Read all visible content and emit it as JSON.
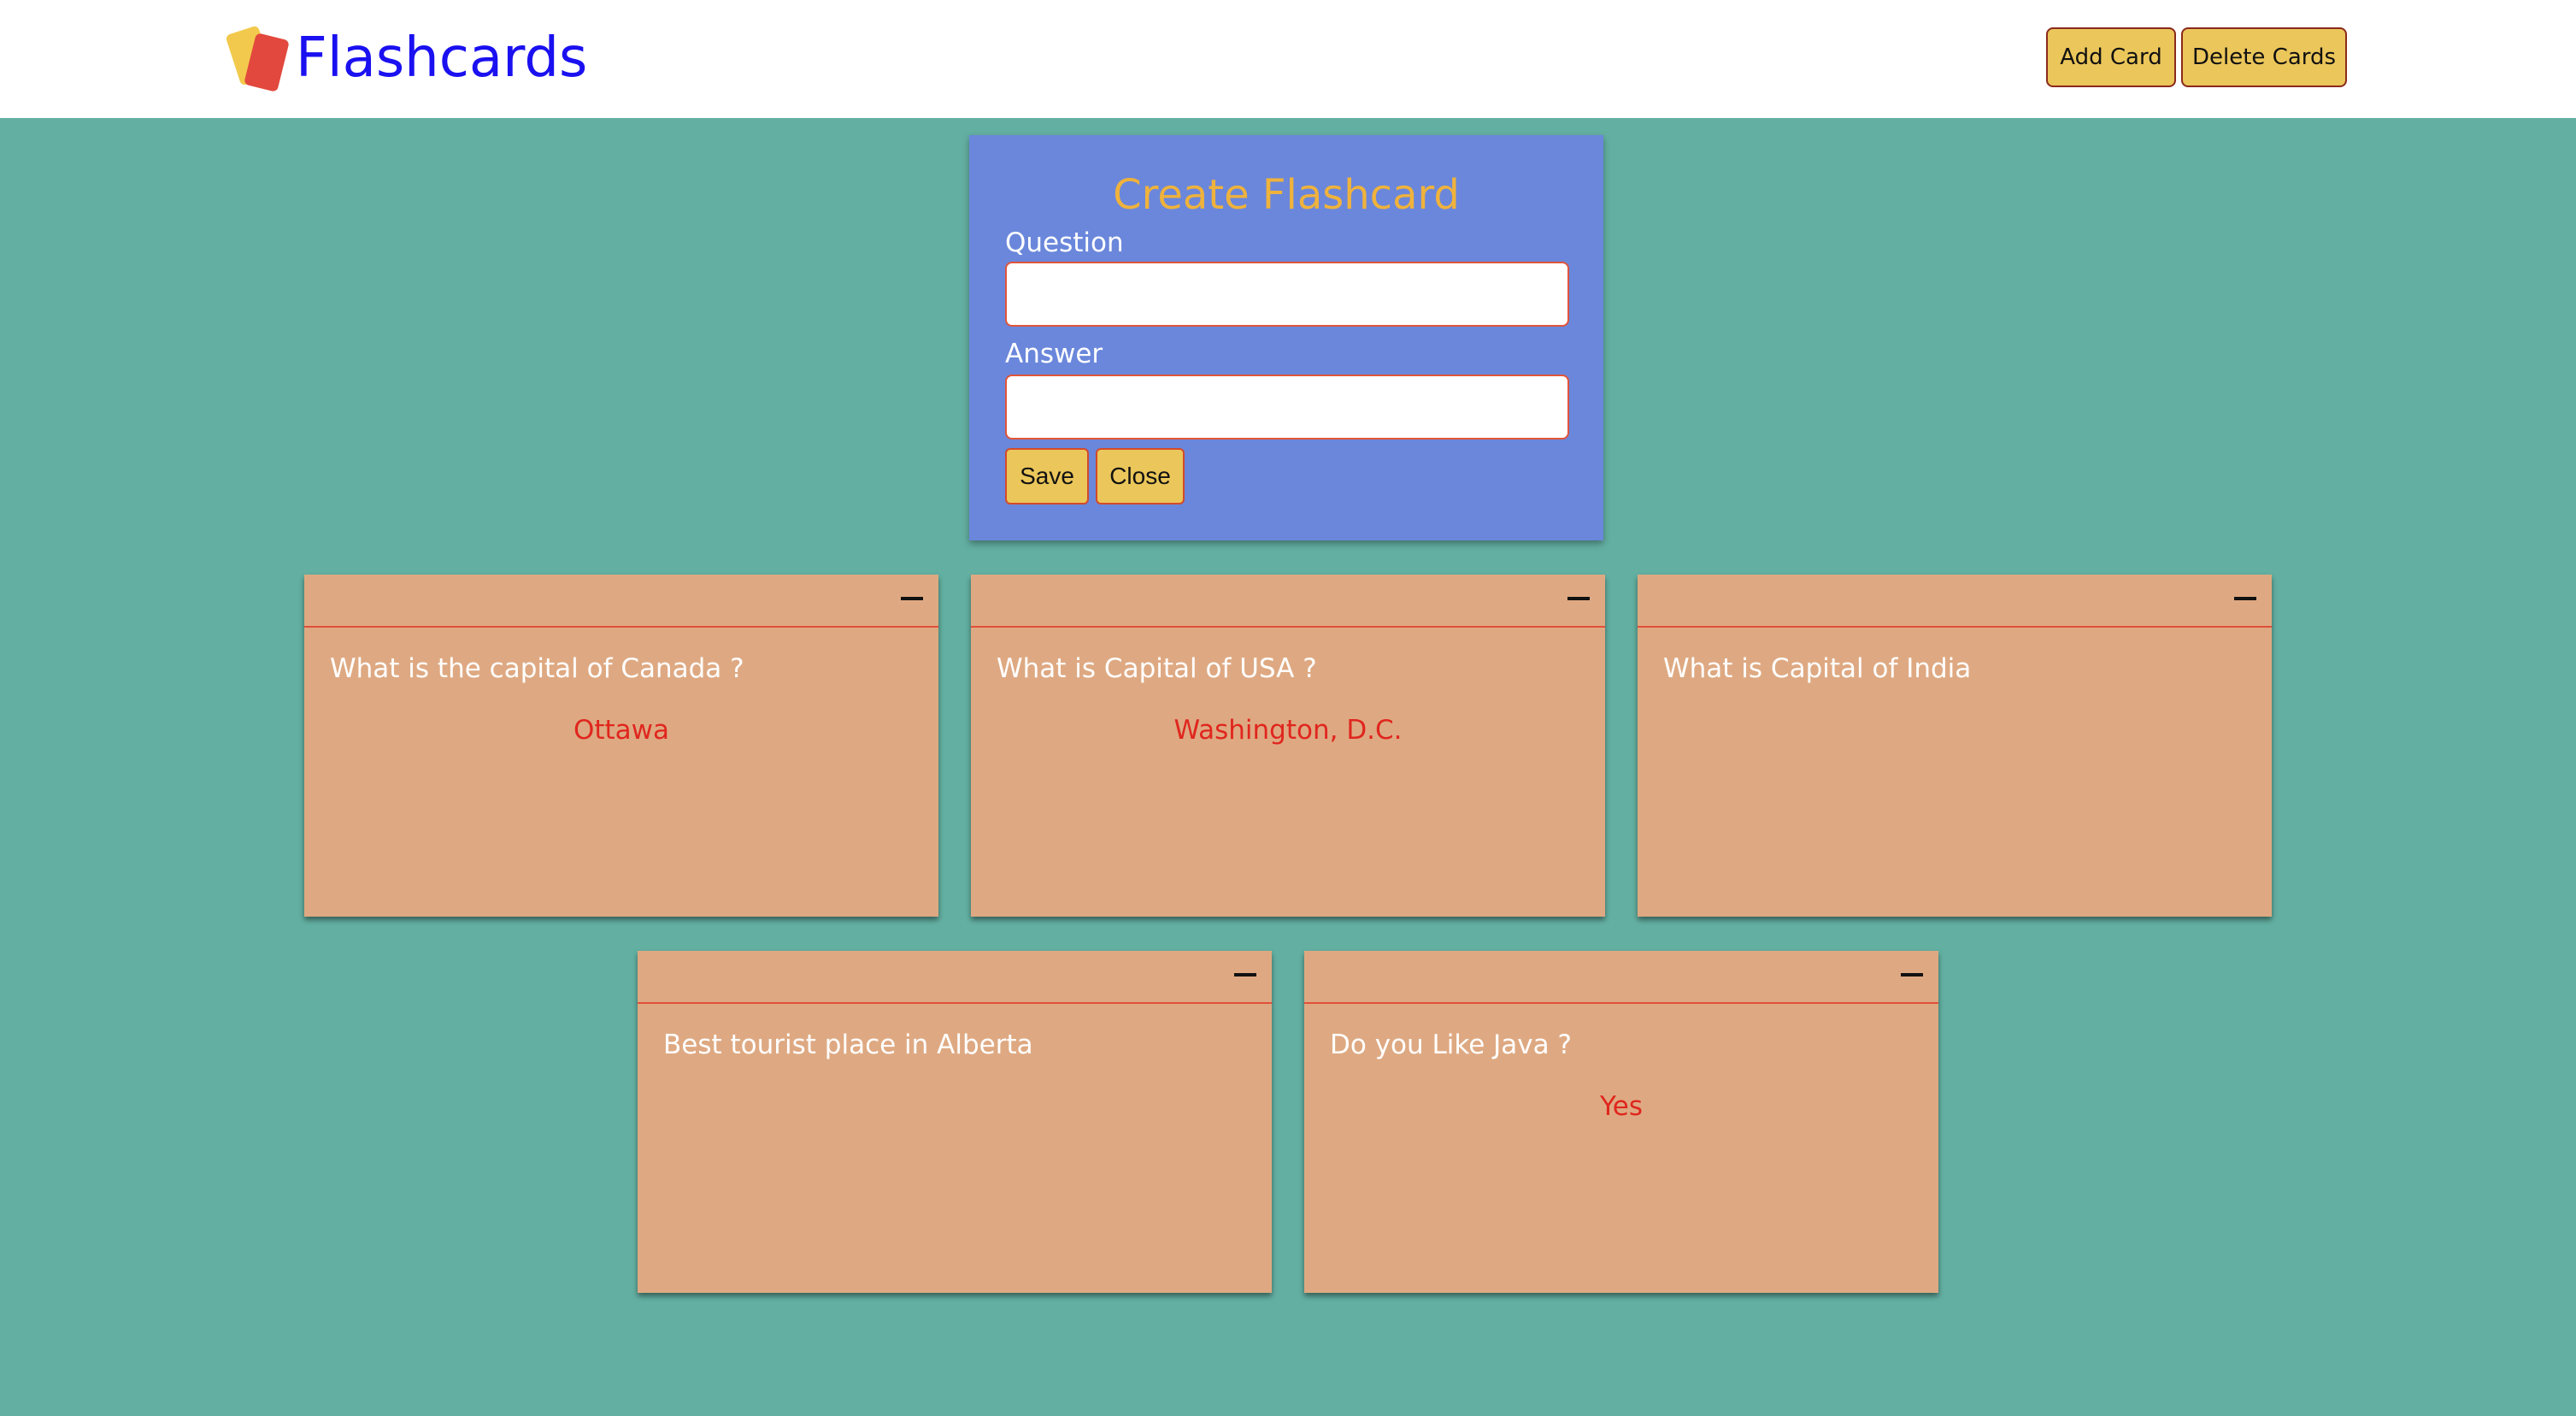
{
  "header": {
    "brand": "Flashcards",
    "add_card_label": "Add Card",
    "delete_cards_label": "Delete Cards"
  },
  "create_panel": {
    "title": "Create Flashcard",
    "question_label": "Question",
    "question_value": "",
    "answer_label": "Answer",
    "answer_value": "",
    "save_label": "Save",
    "close_label": "Close"
  },
  "cards": [
    {
      "question": "What is the capital of Canada ?",
      "answer": "Ottawa"
    },
    {
      "question": "What is Capital of USA ?",
      "answer": "Washington, D.C."
    },
    {
      "question": "What is Capital of India",
      "answer": ""
    },
    {
      "question": "Best tourist place in Alberta",
      "answer": ""
    },
    {
      "question": "Do you Like Java ?",
      "answer": "Yes"
    }
  ],
  "icons": {
    "logo": "flashcards-logo-icon",
    "remove_card": "minus-icon"
  },
  "colors": {
    "background": "#63b0a2",
    "header_background": "#ffffff",
    "brand": "#1a10f0",
    "button": "#ebc65a",
    "panel": "#6a87db",
    "panel_title": "#efb23c",
    "card": "#dea982",
    "answer": "#e0261e",
    "card_rule": "#e0503a"
  }
}
